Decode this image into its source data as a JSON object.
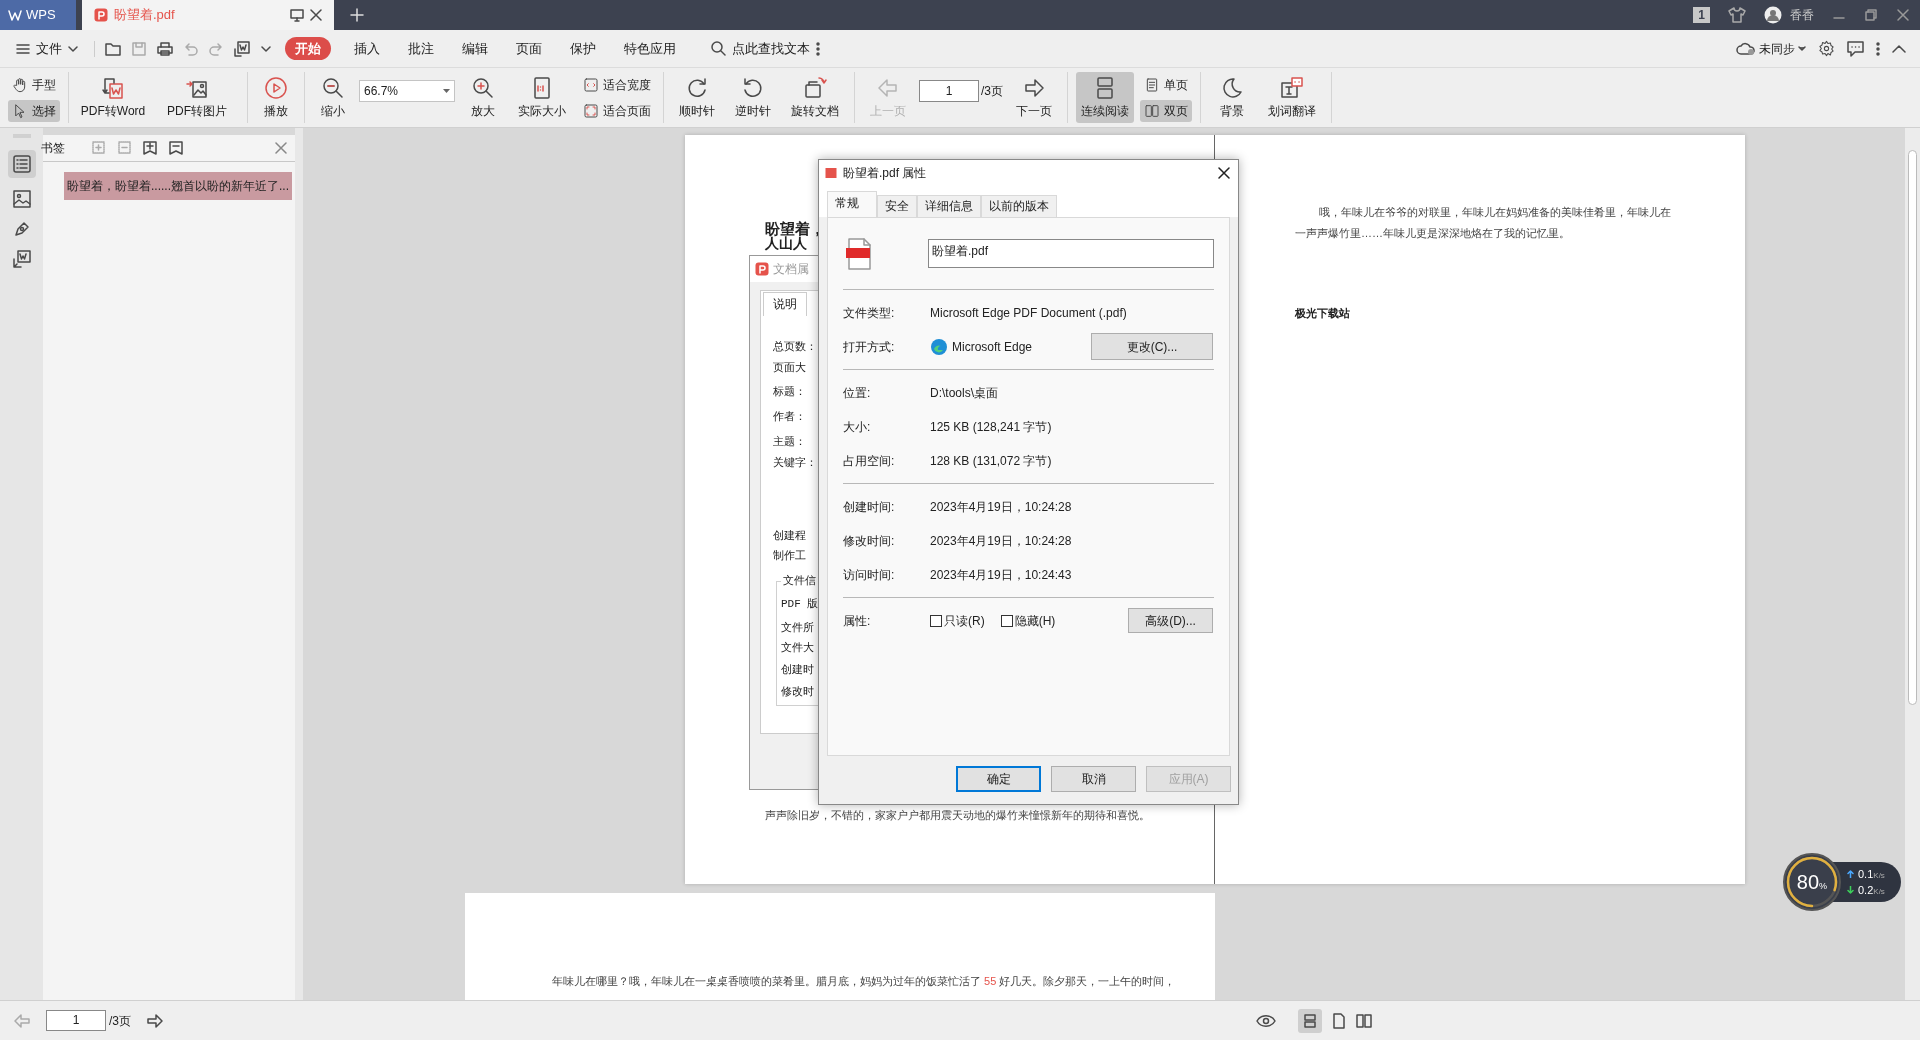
{
  "title_bar": {
    "app": "WPS",
    "tab": {
      "title": "盼望着.pdf"
    },
    "badge": "1",
    "user": "香香"
  },
  "menu_bar": {
    "file": "文件",
    "tabs": [
      {
        "label": "开始",
        "selected": true
      },
      {
        "label": "插入",
        "selected": false
      },
      {
        "label": "批注",
        "selected": false
      },
      {
        "label": "编辑",
        "selected": false
      },
      {
        "label": "页面",
        "selected": false
      },
      {
        "label": "保护",
        "selected": false
      },
      {
        "label": "特色应用",
        "selected": false
      }
    ],
    "search": "点此查找文本",
    "sync": "未同步"
  },
  "toolbar": {
    "groups": [
      [
        {
          "kind": "stack",
          "items": [
            {
              "label": "手型",
              "selected": false
            },
            {
              "label": "选择",
              "selected": true
            }
          ]
        }
      ],
      [
        {
          "kind": "big",
          "label": "PDF转Word"
        },
        {
          "kind": "big",
          "label": "PDF转图片"
        }
      ],
      [
        {
          "kind": "big",
          "label": "播放"
        }
      ],
      [
        {
          "kind": "big",
          "label": "缩小"
        },
        {
          "kind": "zoom",
          "value": "66.7%"
        },
        {
          "kind": "big",
          "label": "放大"
        },
        {
          "kind": "big",
          "label": "实际大小"
        },
        {
          "kind": "stack",
          "items": [
            {
              "label": "适合宽度",
              "selected": false
            },
            {
              "label": "适合页面",
              "selected": false
            }
          ]
        }
      ],
      [
        {
          "kind": "big",
          "label": "顺时针"
        },
        {
          "kind": "big",
          "label": "逆时针"
        },
        {
          "kind": "big",
          "label": "旋转文档"
        }
      ],
      [
        {
          "kind": "big",
          "label": "上一页",
          "disabled": true
        },
        {
          "kind": "page",
          "value": "1",
          "total": "/3页"
        },
        {
          "kind": "big",
          "label": "下一页",
          "disabled": false
        }
      ],
      [
        {
          "kind": "big",
          "label": "连续阅读",
          "selected": true
        },
        {
          "kind": "stack",
          "items": [
            {
              "label": "单页",
              "selected": false
            },
            {
              "label": "双页",
              "selected": true
            }
          ]
        }
      ],
      [
        {
          "kind": "big",
          "label": "背景"
        },
        {
          "kind": "big",
          "label": "划词翻译"
        }
      ]
    ]
  },
  "bookmarks": {
    "title": "书签",
    "items": [
      {
        "label": "盼望着，盼望着......翘首以盼的新年近了...",
        "selected": true
      }
    ]
  },
  "document": {
    "left_page": {
      "heading": "盼望着，",
      "cut_line": "人山人",
      "bottom_line": "声声除旧岁，不错的，家家户户都用震天动地的爆竹来憧憬新年的期待和喜悦。"
    },
    "right_page": {
      "paragraph_lines": [
        "哦，年味儿在爷爷的对联里，年味儿在妈妈准备的美味佳肴里，年味儿在",
        "一声声爆竹里……年味儿更是深深地烙在了我的记忆里。"
      ],
      "signature": "极光下载站"
    },
    "next_page": {
      "line": [
        {
          "text": "年味儿在哪里？哦，年味儿在一桌桌香喷喷的菜肴里。腊月底，妈妈为过年的饭菜忙活了 ",
          "highlight": false
        },
        {
          "text": "55",
          "highlight": true
        },
        {
          "text": " 好几天。除夕那天，一上午的时间，",
          "highlight": false
        }
      ]
    }
  },
  "doc_properties_dialog": {
    "title": "文档属",
    "tab": "说明",
    "labels": [
      "总页数：",
      "页面大",
      "标题：",
      "作者：",
      "主题：",
      "关键字：",
      "创建程",
      "制作工"
    ],
    "group": {
      "title": "文件信",
      "labels": [
        "PDF 版",
        "文件所",
        "文件大",
        "创建时",
        "修改时"
      ]
    }
  },
  "file_properties_dialog": {
    "title": "盼望着.pdf 属性",
    "tabs": [
      {
        "label": "常规",
        "selected": true
      },
      {
        "label": "安全",
        "selected": false
      },
      {
        "label": "详细信息",
        "selected": false
      },
      {
        "label": "以前的版本",
        "selected": false
      }
    ],
    "filename": "盼望着.pdf",
    "sections": [
      [
        {
          "kind": "text",
          "label": "文件类型:",
          "value": "Microsoft Edge PDF Document (.pdf)"
        },
        {
          "kind": "app",
          "label": "打开方式:",
          "value": "Microsoft Edge",
          "button": "更改(C)..."
        }
      ],
      [
        {
          "kind": "text",
          "label": "位置:",
          "value": "D:\\tools\\桌面"
        },
        {
          "kind": "text",
          "label": "大小:",
          "value": "125 KB (128,241 字节)"
        },
        {
          "kind": "text",
          "label": "占用空间:",
          "value": "128 KB (131,072 字节)"
        }
      ],
      [
        {
          "kind": "text",
          "label": "创建时间:",
          "value": "2023年4月19日，10:24:28"
        },
        {
          "kind": "text",
          "label": "修改时间:",
          "value": "2023年4月19日，10:24:28"
        },
        {
          "kind": "text",
          "label": "访问时间:",
          "value": "2023年4月19日，10:24:43"
        }
      ],
      [
        {
          "kind": "attributes",
          "label": "属性:",
          "checkboxes": [
            {
              "label": "只读(R)",
              "checked": false
            },
            {
              "label": "隐藏(H)",
              "checked": false
            }
          ],
          "button": "高级(D)..."
        }
      ]
    ],
    "buttons": [
      {
        "label": "确定",
        "default": true,
        "disabled": false
      },
      {
        "label": "取消",
        "default": false,
        "disabled": false
      },
      {
        "label": "应用(A)",
        "default": false,
        "disabled": true
      }
    ]
  },
  "status_bar": {
    "page": "1",
    "total": "/3页"
  },
  "network_widget": {
    "value": "80",
    "unit": "%",
    "upload": "0.1",
    "download": "0.2",
    "upload_unit": "K/s",
    "download_unit": "K/s"
  }
}
